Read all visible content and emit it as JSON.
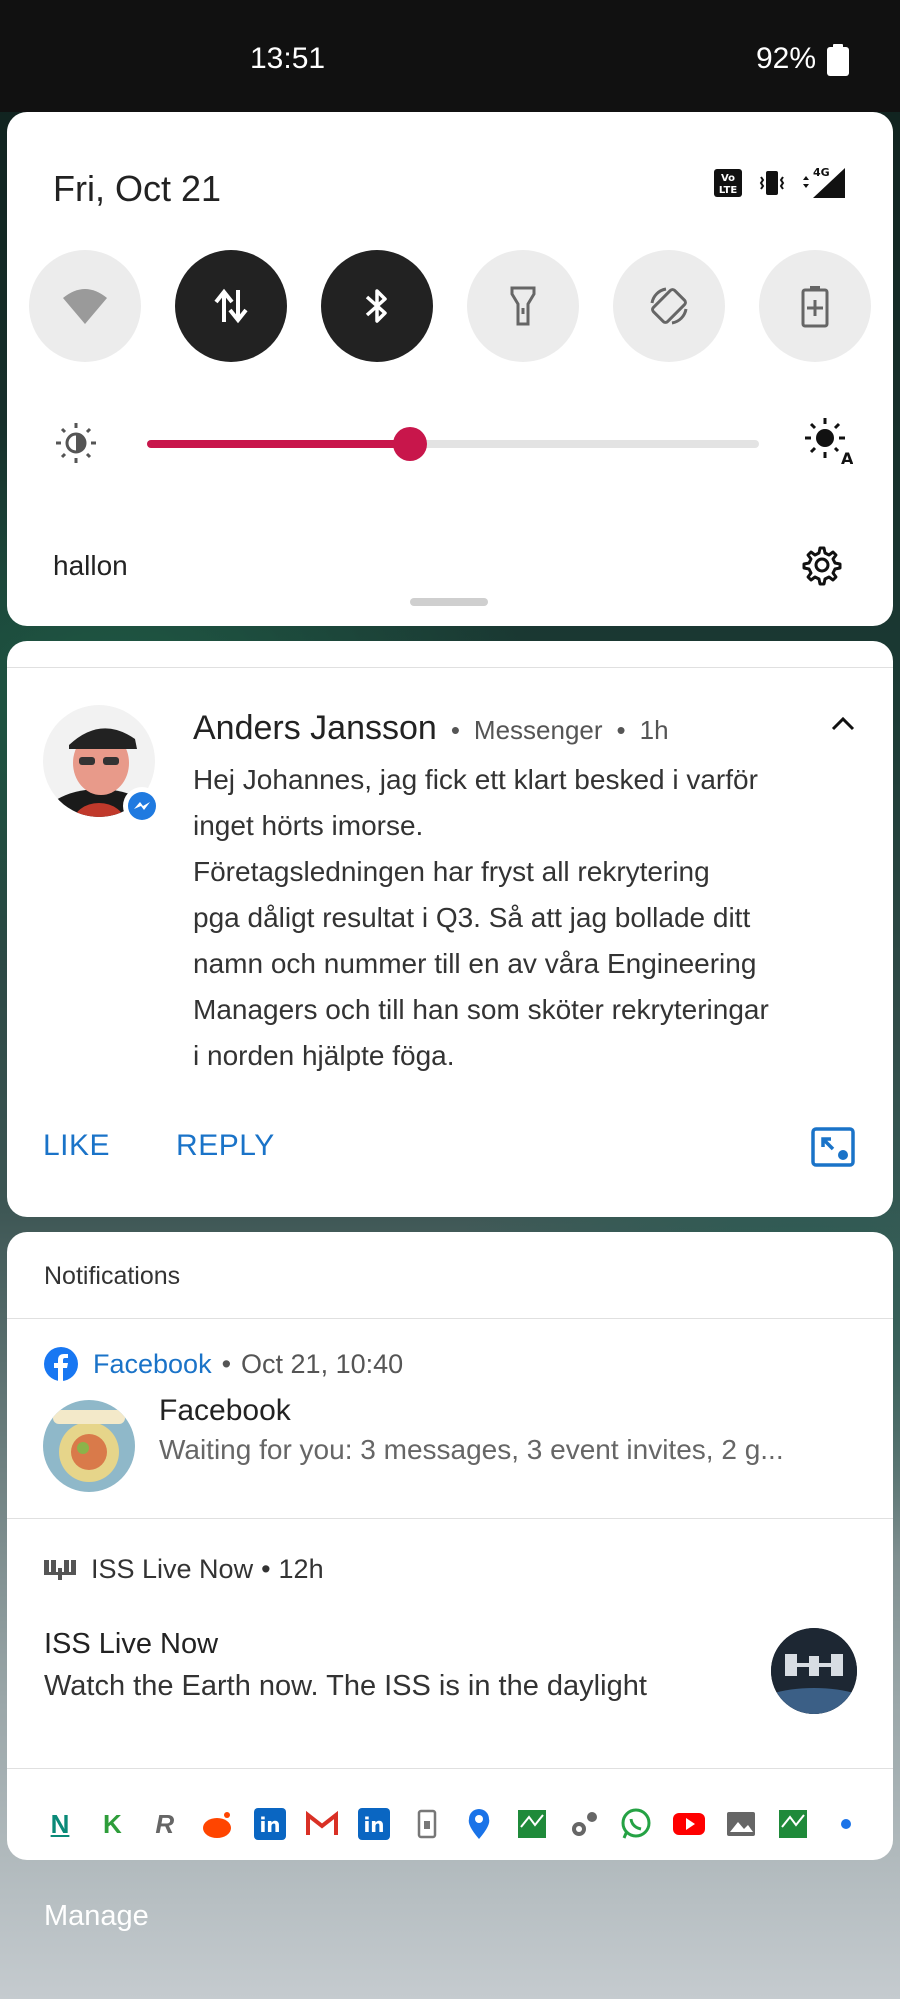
{
  "status_bar": {
    "time": "13:51",
    "battery": "92%"
  },
  "quick_settings": {
    "date": "Fri, Oct 21",
    "network_label": "4G",
    "volte_label": "Vo LTE",
    "carrier": "hallon",
    "brightness_percent": 43,
    "tiles": [
      {
        "name": "wifi",
        "active": false
      },
      {
        "name": "mobile-data",
        "active": true
      },
      {
        "name": "bluetooth",
        "active": true
      },
      {
        "name": "flashlight",
        "active": false
      },
      {
        "name": "auto-rotate",
        "active": false
      },
      {
        "name": "battery-saver",
        "active": false
      }
    ],
    "accent_color": "#c8164b"
  },
  "message": {
    "sender": "Anders Jansson",
    "app": "Messenger",
    "age": "1h",
    "body": [
      "Hej Johannes, jag fick ett klart besked i varför",
      "inget hörts imorse.",
      "Företagsledningen har fryst all rekrytering",
      "pga dåligt resultat i Q3. Så att jag bollade ditt",
      "namn och nummer till en av våra Engineering",
      "Managers och till han som sköter rekryteringar",
      "i norden hjälpte föga."
    ],
    "actions": {
      "like": "LIKE",
      "reply": "REPLY"
    },
    "action_color": "#1a73c8"
  },
  "notifications": {
    "section_title": "Notifications",
    "facebook": {
      "app": "Facebook",
      "time": "Oct 21, 10:40",
      "title": "Facebook",
      "text": "Waiting for you: 3 messages, 3 event invites, 2 g..."
    },
    "iss": {
      "app": "ISS Live Now",
      "age": "12h",
      "title": "ISS Live Now",
      "text": "Watch the Earth now. The ISS is in the daylight"
    },
    "app_icons": [
      "N",
      "K",
      "R",
      "reddit",
      "in",
      "gmail",
      "in",
      "sim",
      "maps",
      "green",
      "settings",
      "whatsapp",
      "youtube",
      "gallery",
      "green",
      "dot"
    ]
  },
  "manage_label": "Manage"
}
